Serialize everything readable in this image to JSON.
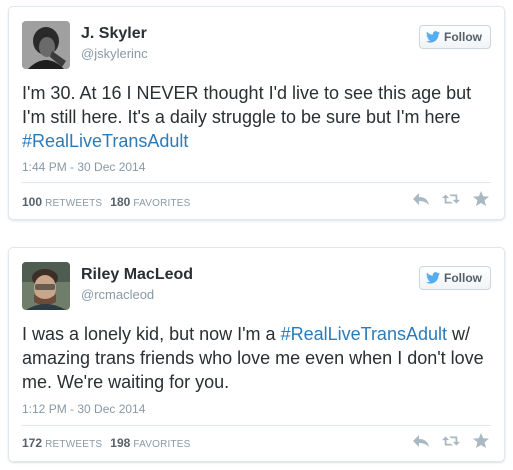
{
  "tweets": [
    {
      "name": "J. Skyler",
      "handle": "@jskylerinc",
      "follow_label": "Follow",
      "text_before": "I'm 30. At 16 I NEVER thought I'd live to see this age but I'm still here. It's a daily struggle to be sure but I'm here ",
      "hashtag": "#RealLiveTransAdult",
      "text_after": "",
      "timestamp": "1:44 PM - 30 Dec 2014",
      "retweets": "100",
      "retweets_label": "RETWEETS",
      "favorites": "180",
      "favorites_label": "FAVORITES"
    },
    {
      "name": "Riley MacLeod",
      "handle": "@rcmacleod",
      "follow_label": "Follow",
      "text_before": "I was a lonely kid, but now I'm a ",
      "hashtag": "#RealLiveTransAdult",
      "text_after": " w/ amazing trans friends who love me even when I don't love me. We're waiting for you.",
      "timestamp": "1:12 PM - 30 Dec 2014",
      "retweets": "172",
      "retweets_label": "RETWEETS",
      "favorites": "198",
      "favorites_label": "FAVORITES"
    }
  ],
  "colors": {
    "link": "#2b7bb9",
    "twitter_blue": "#55acee",
    "text": "#292f33",
    "muted": "#8899a6"
  },
  "icons": [
    "twitter-bird-icon",
    "reply-icon",
    "retweet-icon",
    "favorite-star-icon"
  ]
}
